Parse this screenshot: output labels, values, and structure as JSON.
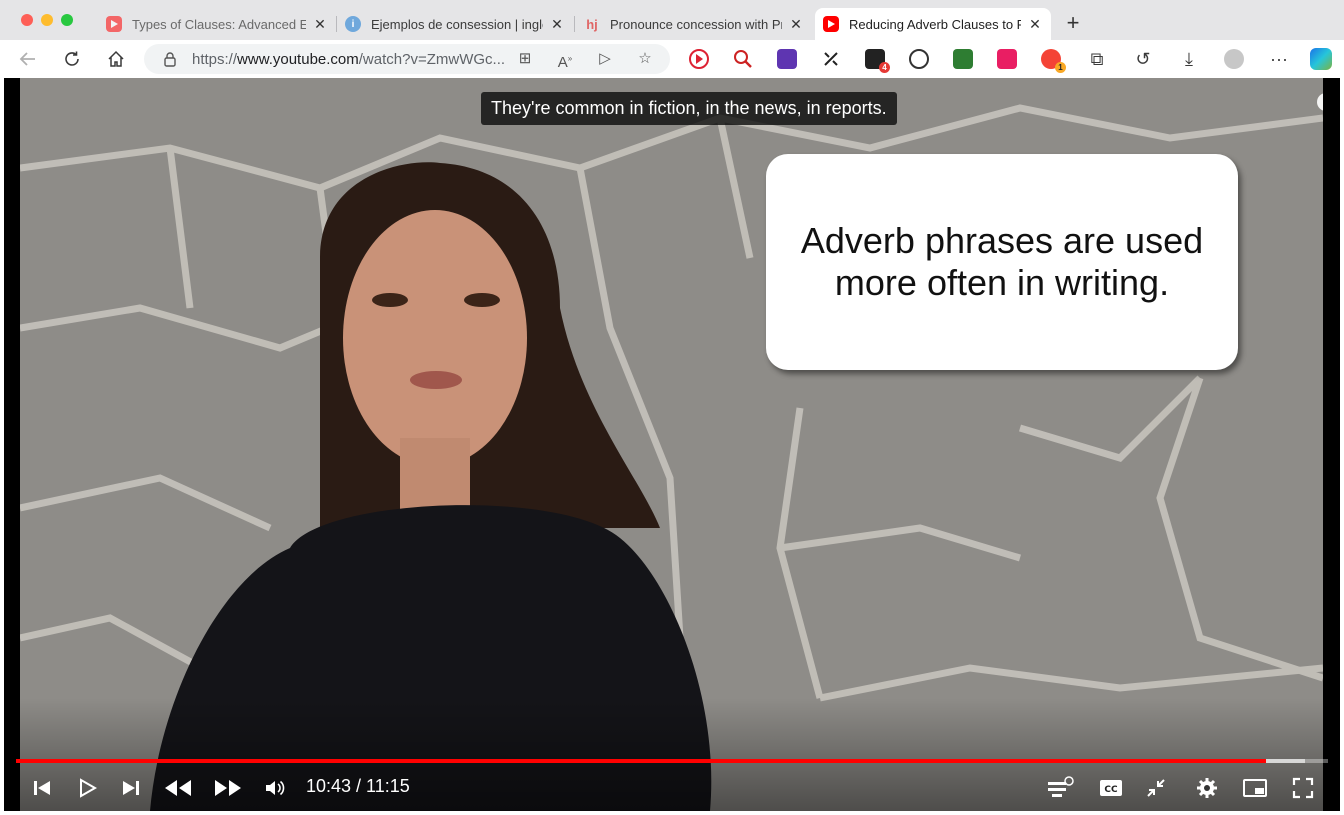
{
  "tabs": [
    {
      "title": "Types of Clauses: Advanced English",
      "favicon": "youtube-icon",
      "active": false
    },
    {
      "title": "Ejemplos de consession | inglés",
      "favicon": "info-icon",
      "active": false
    },
    {
      "title": "Pronounce concession with Pr",
      "favicon": "youglish-icon",
      "active": false
    },
    {
      "title": "Reducing Adverb Clauses to Phrases",
      "favicon": "youtube-icon",
      "active": true
    }
  ],
  "toolbar": {
    "url_prefix": "https://",
    "url_host": "www.youtube.com",
    "url_path": "/watch?v=ZmwWGc...",
    "extension_badges": [
      "4",
      "1"
    ]
  },
  "video": {
    "subtitle": "They're common in fiction, in the news, in reports.",
    "bubble_line1": "Adverb phrases are used",
    "bubble_line2": "more often in writing.",
    "time_display": "10:43 / 11:15",
    "current_seconds": 643,
    "total_seconds": 675,
    "info_label": "i"
  },
  "colors": {
    "youtube_red": "#ff0000",
    "tab_strip": "#e5e5e7",
    "accent_blue": "#1a73e8"
  }
}
